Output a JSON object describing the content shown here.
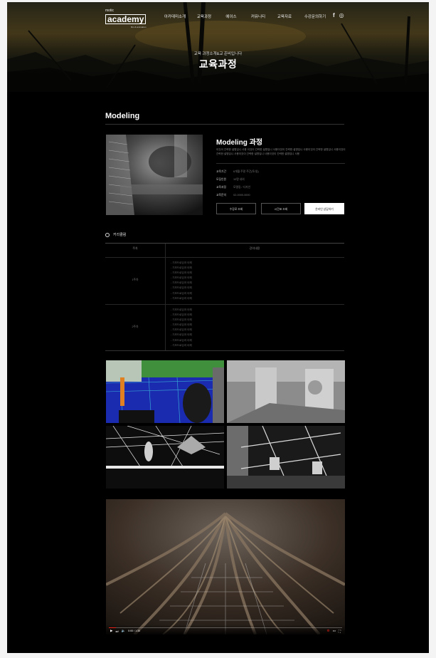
{
  "brand": {
    "top": "motic",
    "name": "academy",
    "tagline": "film & animation"
  },
  "nav": {
    "items": [
      "아카데미소개",
      "교육과정",
      "에이스",
      "커뮤니티",
      "교육자료",
      "수강문의하기"
    ]
  },
  "social": {
    "facebook": "f",
    "instagram": "◎"
  },
  "hero": {
    "subtitle": "교육 과정소개&교 준비입니다",
    "title": "교육과정"
  },
  "section": {
    "title": "Modeling"
  },
  "course": {
    "title": "Modeling 과정",
    "description": "이것이 간략한 설명입니 사용 이것이 간략한 설명입니 사용이것이 간략한 설명입니 사용이것이 간략한 설명입니 사용이것이 간략한 설명입니 사용이것이 간략한 설명입니 사용이것이 간략한 설명입니 사용",
    "info": [
      {
        "label": "교육기간",
        "value": "6개월 주말 주간(토/일)"
      },
      {
        "label": "모집인원",
        "value": "10명 내외"
      },
      {
        "label": "교육과정",
        "value": "모델링 / 디자인"
      },
      {
        "label": "교육문의",
        "value": "02-0000-0000"
      }
    ],
    "buttons": {
      "syllabus": "수강료 조회",
      "schedule": "시간표 조회",
      "inquiry": "온라인 상담하기"
    }
  },
  "curriculum": {
    "heading": "커리큘럼",
    "columns": [
      "주차",
      "강의내용"
    ],
    "rows": [
      {
        "week": "1주차",
        "items": [
          "- 기초드로잉과 이해",
          "- 기초드로잉과 이해",
          "- 기초드로잉과 이해",
          "- 기초드로잉과 이해",
          "- 기초드로잉과 이해",
          "- 기초드로잉과 이해",
          "- 기초드로잉과 이해",
          "- 기초드로잉과 이해"
        ]
      },
      {
        "week": "2주차",
        "items": [
          "- 기초드로잉과 이해",
          "- 기초드로잉과 이해",
          "- 기초드로잉과 이해",
          "- 기초드로잉과 이해",
          "- 기초드로잉과 이해",
          "- 기초드로잉과 이해",
          "- 기초드로잉과 이해",
          "- 기초드로잉과 이해"
        ]
      }
    ]
  },
  "video": {
    "time": "0:00 / 1:30",
    "progress": 0.03
  },
  "colors": {
    "background": "#000000",
    "accent": "#e62117",
    "primary_button": "#ffffff"
  }
}
